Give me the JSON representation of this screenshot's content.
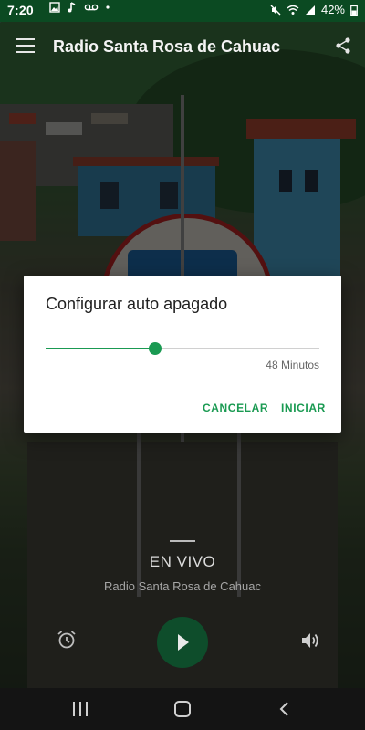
{
  "status_bar": {
    "time": "7:20",
    "battery": "42%",
    "left_icons": [
      "image-icon",
      "music-note-icon",
      "voicemail-icon",
      "dot-icon"
    ],
    "right_icons": [
      "mute-icon",
      "wifi-icon",
      "signal-icon",
      "battery-icon"
    ]
  },
  "app_bar": {
    "title": "Radio Santa Rosa de Cahuac"
  },
  "player": {
    "dash": "---",
    "status": "EN VIVO",
    "station": "Radio Santa Rosa de Cahuac"
  },
  "dialog": {
    "title": "Configurar auto apagado",
    "slider_fraction": 0.4,
    "value_label": "48 Minutos",
    "cancel_label": "CANCELAR",
    "start_label": "INICIAR"
  },
  "colors": {
    "accent": "#1a9a52",
    "status_bar": "#0b4a22",
    "play_button": "#0e4d2b"
  }
}
